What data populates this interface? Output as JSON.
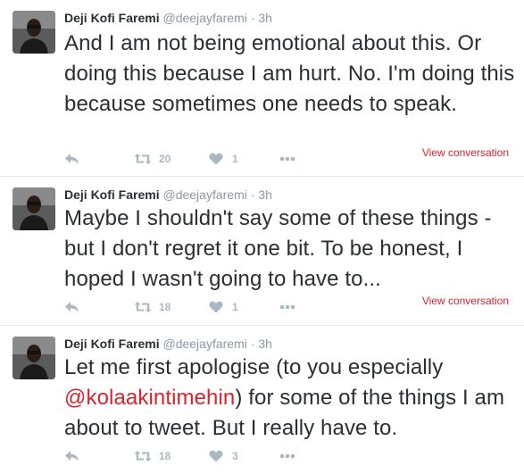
{
  "colors": {
    "link_red": "#d9232e",
    "name_text": "#292f33",
    "meta_gray": "#8899a6",
    "action_gray": "#aab8c2",
    "divider": "#e1e8ed"
  },
  "icons": {
    "reply": "reply-arrow-icon",
    "retweet": "retweet-icon",
    "like": "heart-icon",
    "more": "more-dots-icon"
  },
  "tweets": [
    {
      "author_name": "Deji Kofi Faremi",
      "handle": "@deejayfaremi",
      "separator": "·",
      "time": "3h",
      "text": "And I am not being emotional about this. Or doing this because I am hurt. No. I'm doing this because sometimes one needs to speak.",
      "retweets": "20",
      "likes": "1",
      "view_conversation": "View conversation"
    },
    {
      "author_name": "Deji Kofi Faremi",
      "handle": "@deejayfaremi",
      "separator": "·",
      "time": "3h",
      "text": "Maybe I shouldn't say some of these things - but I don't regret it one bit. To be honest, I hoped I wasn't going to have to...",
      "retweets": "18",
      "likes": "1",
      "view_conversation": "View conversation"
    },
    {
      "author_name": "Deji Kofi Faremi",
      "handle": "@deejayfaremi",
      "separator": "·",
      "time": "3h",
      "text_before": "Let me first apologise (to you especially ",
      "mention": "@kolaakintimehin",
      "text_after": ") for some of the things I am about to tweet. But I really have to.",
      "retweets": "18",
      "likes": "3"
    }
  ]
}
